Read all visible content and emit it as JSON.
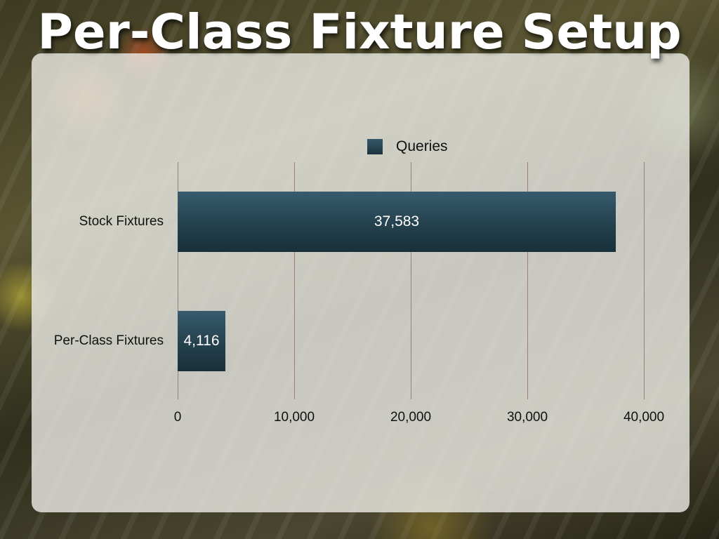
{
  "slide": {
    "title": "Per-Class Fixture Setup"
  },
  "chart_data": {
    "type": "bar",
    "orientation": "horizontal",
    "categories": [
      "Stock Fixtures",
      "Per-Class Fixtures"
    ],
    "series": [
      {
        "name": "Queries",
        "values": [
          37583,
          4116
        ],
        "data_labels": [
          "37,583",
          "4,116"
        ]
      }
    ],
    "xlim": [
      0,
      40000
    ],
    "xticks": [
      0,
      10000,
      20000,
      30000,
      40000
    ],
    "xtick_labels": [
      "0",
      "10,000",
      "20,000",
      "30,000",
      "40,000"
    ],
    "grid": true,
    "legend": "top-center",
    "bar_color": "#24414e"
  }
}
